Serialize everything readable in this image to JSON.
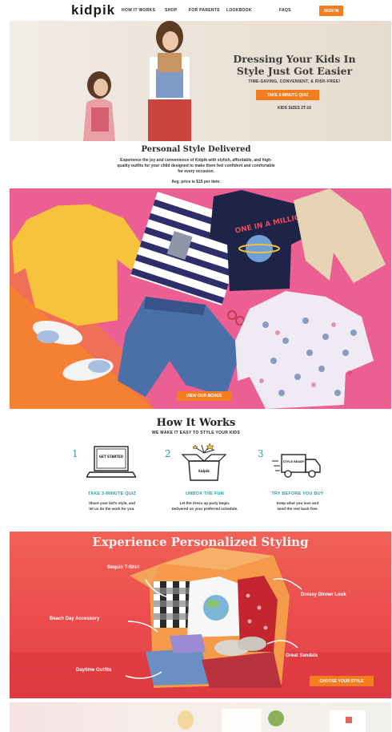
{
  "nav": {
    "logo": "kidpik",
    "links": [
      "HOW IT WORKS",
      "SHOP",
      "FOR PARENTS",
      "LOOKBOOK",
      "FAQS"
    ],
    "signin": "SIGN IN"
  },
  "hero": {
    "title_line1": "Dressing Your Kids In",
    "title_line2": "Style Just Got Easier",
    "subtitle": "TIME-SAVING, CONVENIENT, & RISK-FREE!",
    "cta": "TAKE 3-MINUTE QUIZ",
    "sizes": "KIDS SIZES 2T-16"
  },
  "personal": {
    "title": "Personal Style Delivered",
    "text": "Experience the joy and convenience of Kidpik with stylish, affordable, and high-quality outfits for your child designed to make them feel confident and comfortable for every occasion.",
    "price": "Avg. price is $15 per item."
  },
  "clothes": {
    "tee_print": "ONE IN A MILLION",
    "cta": "VIEW OUR BOXES"
  },
  "how": {
    "title": "How It Works",
    "subtitle": "WE MAKE IT EASY TO STYLE YOUR KIDS",
    "steps": [
      {
        "num": "1",
        "icon_text": "GET STARTED",
        "head": "TAKE 3-MINUTE QUIZ",
        "text1": "Share your kid's style, and",
        "text2": "let us do the work for you."
      },
      {
        "num": "2",
        "icon_text": "kidpik",
        "head": "UNBOX THE FUN",
        "text1": "Let the dress up party begin.",
        "text2": "Delivered on your preferred schedule."
      },
      {
        "num": "3",
        "icon_text": "STYLE READY",
        "head": "TRY BEFORE YOU BUY",
        "text1": "Keep what you love and",
        "text2": "send the rest back free."
      }
    ]
  },
  "styling": {
    "title": "Experience Personalized Styling",
    "labels": {
      "sequin": "Sequin T-Shirt",
      "dressy": "Dressy Dinner Look",
      "beach": "Beach Day Accessory",
      "sandals": "Great Sandals",
      "daytime": "Daytime Outfits"
    },
    "cta": "CHOOSE YOUR STYLE"
  },
  "colors": {
    "accent": "#f47d20",
    "teal": "#1aa5a8",
    "pink": "#ec5f93"
  }
}
